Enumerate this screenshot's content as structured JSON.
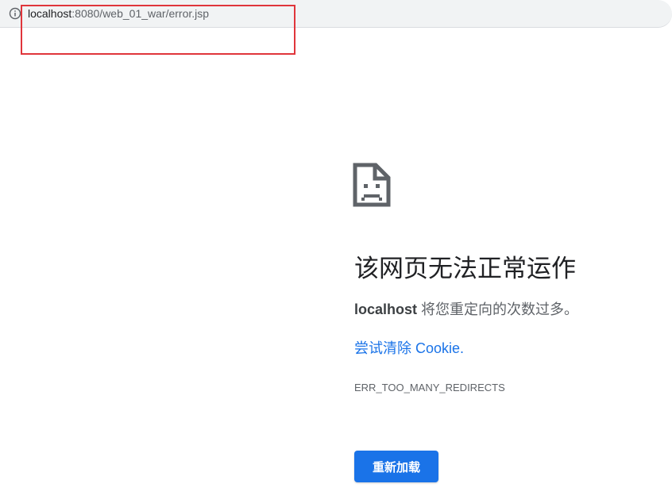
{
  "address_bar": {
    "icon": "info-icon",
    "url_host": "localhost",
    "url_path": ":8080/web_01_war/error.jsp"
  },
  "error_page": {
    "icon": "sad-page-icon",
    "title": "该网页无法正常运作",
    "message_host": "localhost",
    "message_text": " 将您重定向的次数过多。",
    "suggestion": "尝试清除 Cookie.",
    "error_code": "ERR_TOO_MANY_REDIRECTS",
    "reload_label": "重新加载"
  },
  "colors": {
    "accent": "#1a73e8",
    "highlight": "#e0353b",
    "toolbar_bg": "#f1f3f4"
  }
}
